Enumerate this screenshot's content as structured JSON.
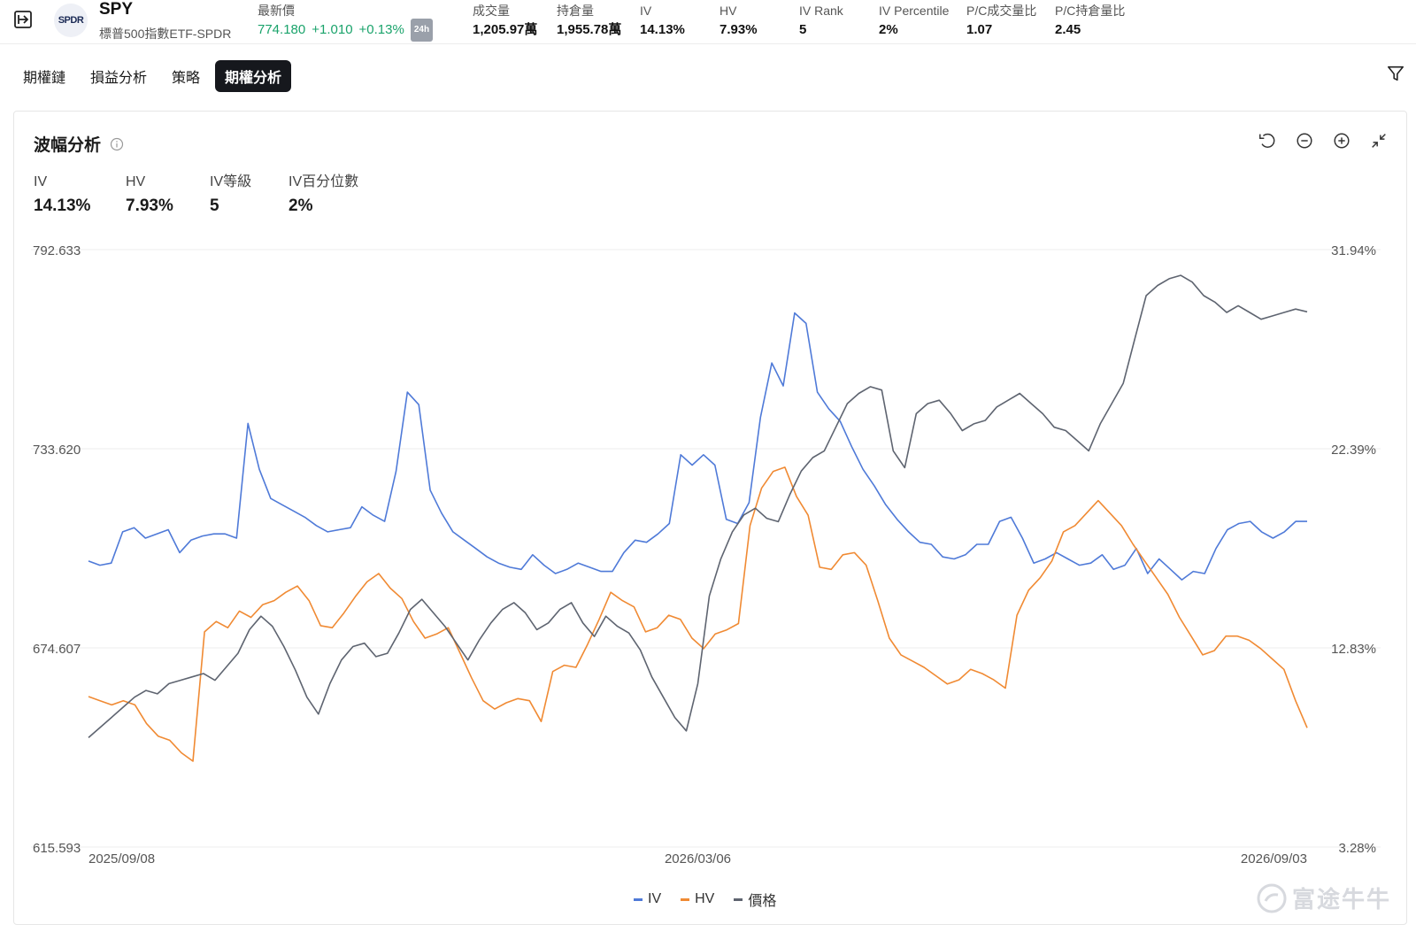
{
  "header": {
    "logo_text": "SPDR",
    "ticker": "SPY",
    "full_name": "標普500指數ETF-SPDR",
    "latest_price_label": "最新價",
    "latest_price": "774.180",
    "change": "+1.010",
    "change_pct": "+0.13%",
    "session_badge": "24h",
    "stats": [
      {
        "label": "成交量",
        "value": "1,205.97萬"
      },
      {
        "label": "持倉量",
        "value": "1,955.78萬"
      },
      {
        "label": "IV",
        "value": "14.13%"
      },
      {
        "label": "HV",
        "value": "7.93%"
      },
      {
        "label": "IV Rank",
        "value": "5"
      },
      {
        "label": "IV Percentile",
        "value": "2%"
      },
      {
        "label": "P/C成交量比",
        "value": "1.07"
      },
      {
        "label": "P/C持倉量比",
        "value": "2.45"
      }
    ]
  },
  "tabs": [
    {
      "label": "期權鏈",
      "active": false
    },
    {
      "label": "損益分析",
      "active": false
    },
    {
      "label": "策略",
      "active": false
    },
    {
      "label": "期權分析",
      "active": true
    }
  ],
  "card": {
    "title": "波幅分析",
    "metrics": [
      {
        "label": "IV",
        "value": "14.13%"
      },
      {
        "label": "HV",
        "value": "7.93%"
      },
      {
        "label": "IV等級",
        "value": "5"
      },
      {
        "label": "IV百分位數",
        "value": "2%"
      }
    ]
  },
  "chart_data": {
    "type": "line",
    "title": "",
    "left_axis": {
      "ticks": [
        "792.633",
        "733.620",
        "674.607",
        "615.593"
      ],
      "range": [
        615.593,
        792.633
      ],
      "series": "價格"
    },
    "right_axis": {
      "ticks": [
        "31.94%",
        "22.39%",
        "12.83%",
        "3.28%"
      ],
      "range": [
        3.28,
        31.94
      ],
      "series": [
        "IV",
        "HV"
      ]
    },
    "x_ticks": [
      "2025/09/08",
      "2026/03/06",
      "2026/09/03"
    ],
    "grid": true,
    "legend_position": "bottom",
    "series": [
      {
        "name": "IV",
        "color": "#4f7ad8",
        "axis": "right",
        "values": [
          17.0,
          16.8,
          16.9,
          18.4,
          18.6,
          18.1,
          18.3,
          18.5,
          17.4,
          18.0,
          18.2,
          18.3,
          18.3,
          18.1,
          23.6,
          21.4,
          20.0,
          19.7,
          19.4,
          19.1,
          18.7,
          18.4,
          18.5,
          18.6,
          19.6,
          19.2,
          18.9,
          21.3,
          25.1,
          24.5,
          20.4,
          19.3,
          18.4,
          18.0,
          17.6,
          17.2,
          16.9,
          16.7,
          16.6,
          17.3,
          16.8,
          16.4,
          16.6,
          16.9,
          16.7,
          16.5,
          16.5,
          17.4,
          18.0,
          17.9,
          18.3,
          18.8,
          22.1,
          21.6,
          22.1,
          21.6,
          19.0,
          18.8,
          19.8,
          23.9,
          26.5,
          25.4,
          28.9,
          28.4,
          25.1,
          24.3,
          23.7,
          22.5,
          21.4,
          20.6,
          19.7,
          19.0,
          18.4,
          17.9,
          17.8,
          17.2,
          17.1,
          17.3,
          17.8,
          17.8,
          18.9,
          19.1,
          18.1,
          16.9,
          17.1,
          17.4,
          17.1,
          16.8,
          16.9,
          17.3,
          16.6,
          16.8,
          17.6,
          16.4,
          17.1,
          16.6,
          16.1,
          16.5,
          16.4,
          17.6,
          18.5,
          18.8,
          18.9,
          18.4,
          18.1,
          18.4,
          18.9,
          18.9
        ],
        "note": "approximate reading"
      },
      {
        "name": "HV",
        "color": "#f08a33",
        "axis": "right",
        "values": [
          10.5,
          10.3,
          10.1,
          10.3,
          10.1,
          9.2,
          8.6,
          8.4,
          7.8,
          7.4,
          13.6,
          14.1,
          13.8,
          14.6,
          14.3,
          14.9,
          15.1,
          15.5,
          15.8,
          15.1,
          13.9,
          13.8,
          14.5,
          15.3,
          16.0,
          16.4,
          15.7,
          15.2,
          14.1,
          13.3,
          13.5,
          13.8,
          12.6,
          11.4,
          10.3,
          9.9,
          10.2,
          10.4,
          10.3,
          9.3,
          11.7,
          12.0,
          11.9,
          13.0,
          14.2,
          15.5,
          15.1,
          14.8,
          13.6,
          13.8,
          14.4,
          14.2,
          13.3,
          12.8,
          13.5,
          13.7,
          14.0,
          18.7,
          20.5,
          21.3,
          21.5,
          20.1,
          19.2,
          16.7,
          16.6,
          17.3,
          17.4,
          16.8,
          15.1,
          13.3,
          12.5,
          12.2,
          11.9,
          11.5,
          11.1,
          11.3,
          11.8,
          11.6,
          11.3,
          10.9,
          14.4,
          15.6,
          16.2,
          17.0,
          18.4,
          18.7,
          19.3,
          19.9,
          19.3,
          18.7,
          17.8,
          17.0,
          16.2,
          15.4,
          14.3,
          13.4,
          12.5,
          12.7,
          13.4,
          13.4,
          13.2,
          12.8,
          12.3,
          11.8,
          10.3,
          9.0
        ]
      },
      {
        "name": "價格",
        "color": "#5e6470",
        "axis": "left",
        "values": [
          648.0,
          651.0,
          654.0,
          657.0,
          660.0,
          662.0,
          661.0,
          664.0,
          665.0,
          666.0,
          667.0,
          665.0,
          669.0,
          673.0,
          680.0,
          684.0,
          681.0,
          675.0,
          668.0,
          660.0,
          655.0,
          664.0,
          671.0,
          675.0,
          676.0,
          672.0,
          673.0,
          679.0,
          686.0,
          689.0,
          685.0,
          681.0,
          676.0,
          671.0,
          677.0,
          682.0,
          686.0,
          688.0,
          685.0,
          680.0,
          682.0,
          686.0,
          688.0,
          682.0,
          678.0,
          684.0,
          681.0,
          679.0,
          674.0,
          666.0,
          660.0,
          654.0,
          650.0,
          664.0,
          690.0,
          701.0,
          709.0,
          714.0,
          716.0,
          713.0,
          712.0,
          720.0,
          727.0,
          731.0,
          733.0,
          740.0,
          747.0,
          750.0,
          752.0,
          751.0,
          733.0,
          728.0,
          744.0,
          747.0,
          748.0,
          744.0,
          739.0,
          741.0,
          742.0,
          746.0,
          748.0,
          750.0,
          747.0,
          744.0,
          740.0,
          739.0,
          736.0,
          733.0,
          741.0,
          747.0,
          753.0,
          766.0,
          779.0,
          782.0,
          784.0,
          785.0,
          783.0,
          779.0,
          777.0,
          774.0,
          776.0,
          774.0,
          772.0,
          773.0,
          774.0,
          775.0,
          774.2
        ]
      }
    ]
  },
  "legend": [
    {
      "label": "IV",
      "color": "#4f7ad8"
    },
    {
      "label": "HV",
      "color": "#f08a33"
    },
    {
      "label": "價格",
      "color": "#5e6470"
    }
  ],
  "watermark": "富途牛牛"
}
